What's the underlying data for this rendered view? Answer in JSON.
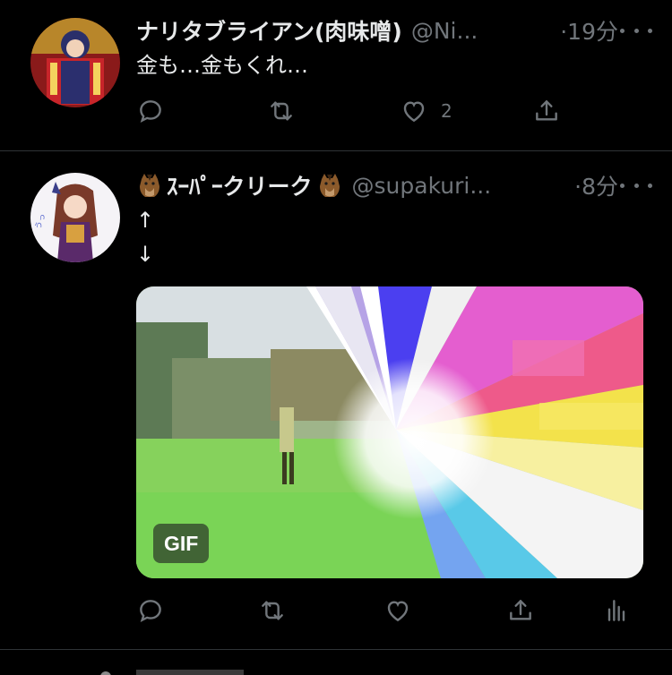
{
  "tweets": [
    {
      "name": "ナリタブライアン(肉味噌)",
      "handle": "@Ni...",
      "time": "·19分",
      "text": "金も…金もくれ…",
      "actions": {
        "reply_icon": "reply-icon",
        "retweet_icon": "retweet-icon",
        "like_icon": "heart-icon",
        "like_count": "2",
        "share_icon": "share-icon"
      }
    },
    {
      "name": "ｽｰﾊﾟｰクリーク",
      "name_emoji": "horse-face-emoji",
      "handle": "@supakuri...",
      "time": "·8分",
      "text_line1": "↑",
      "text_line2": "↓",
      "media_badge": "GIF",
      "actions": {
        "reply_icon": "reply-icon",
        "retweet_icon": "retweet-icon",
        "like_icon": "heart-icon",
        "share_icon": "share-icon",
        "analytics_icon": "analytics-icon"
      }
    }
  ],
  "colors": {
    "background": "#000000",
    "text_primary": "#e7e9ea",
    "text_secondary": "#71767b",
    "divider": "#2f3336"
  }
}
